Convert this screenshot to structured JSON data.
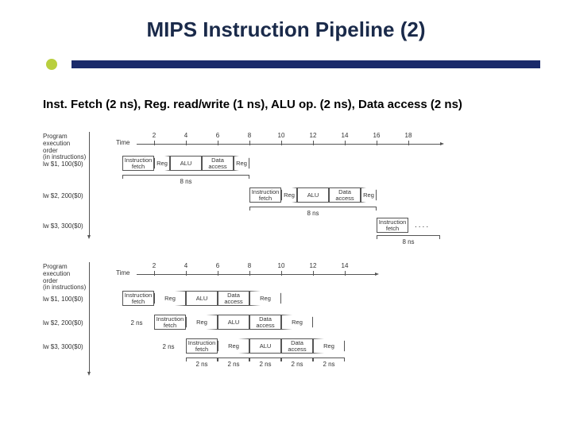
{
  "title": "MIPS Instruction Pipeline (2)",
  "subtitle": "Inst. Fetch (2 ns), Reg. read/write (1 ns), ALU op. (2 ns), Data access (2 ns)",
  "axisLabel": "Program\nexecution\norder\n(in instructions)",
  "timeLabel": "Time",
  "seq": {
    "ticks": [
      "2",
      "4",
      "6",
      "8",
      "10",
      "12",
      "14",
      "16",
      "18"
    ],
    "instrs": [
      "lw $1, 100($0)",
      "lw $2, 200($0)",
      "lw $3, 300($0)"
    ],
    "stages": [
      "Instruction\nfetch",
      "Reg",
      "ALU",
      "Data\naccess",
      "Reg"
    ],
    "gap": "8 ns"
  },
  "pipe": {
    "ticks": [
      "2",
      "4",
      "6",
      "8",
      "10",
      "12",
      "14"
    ],
    "instrs": [
      "lw $1, 100($0)",
      "lw $2, 200($0)",
      "lw $3, 300($0)"
    ],
    "stages": [
      "Instruction\nfetch",
      "Reg",
      "ALU",
      "Data\naccess",
      "Reg"
    ],
    "gaps": [
      "2 ns",
      "2 ns",
      "2 ns",
      "2 ns",
      "2 ns",
      "2 ns",
      "2 ns"
    ]
  },
  "dots": "...."
}
